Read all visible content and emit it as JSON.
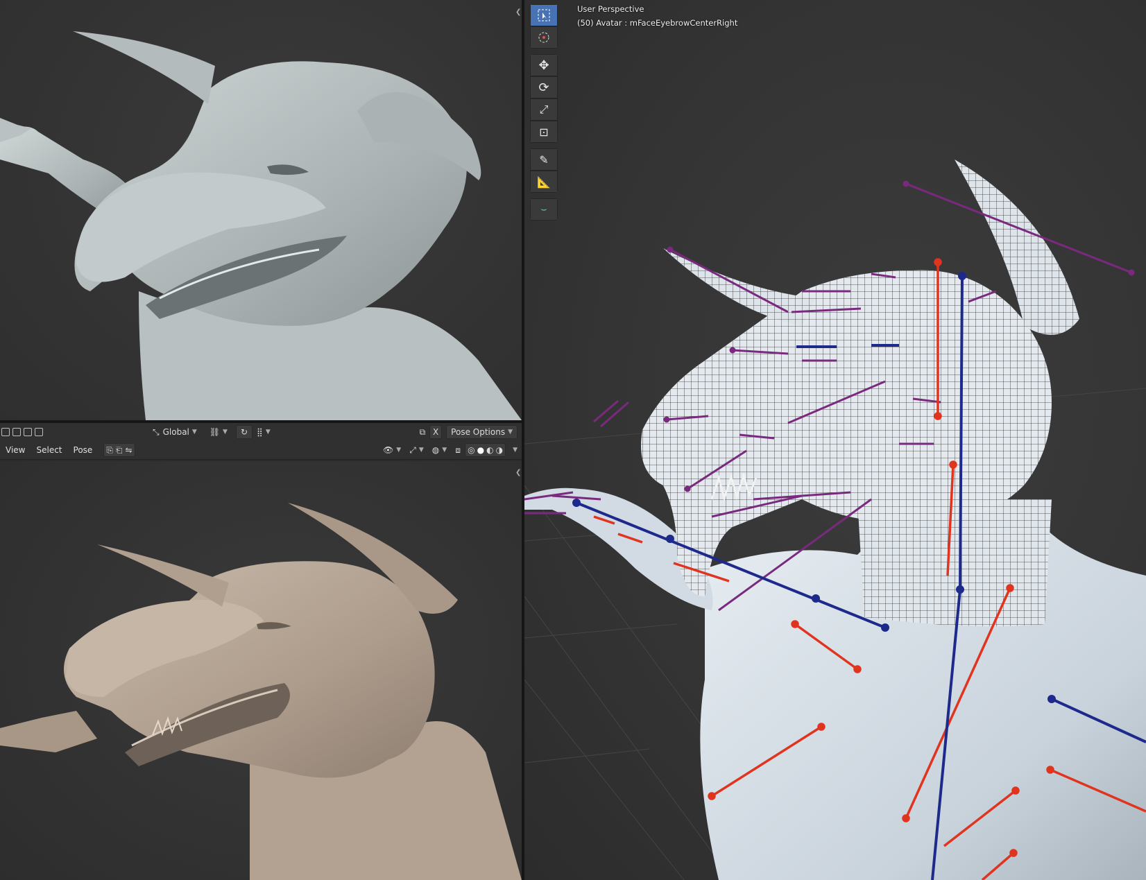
{
  "viewport_right": {
    "title": "User Perspective",
    "subtitle": "(50) Avatar : mFaceEyebrowCenterRight"
  },
  "header_tools": {
    "orientation": "Global",
    "pose_options": "Pose Options",
    "x_mirror": "X"
  },
  "header_menu": {
    "view": "View",
    "select": "Select",
    "pose": "Pose"
  },
  "toolbar": [
    "select-box",
    "cursor",
    "move",
    "rotate",
    "scale",
    "transform",
    "annotate",
    "measure",
    "relax-pose"
  ],
  "colors": {
    "bone_purple": "#7a2a7e",
    "bone_red": "#e0341f",
    "bone_blue": "#1d2a8c",
    "model_grey": "#b7bec0",
    "model_clay": "#b9a898",
    "model_white": "#d6dee6",
    "accent": "#4772b3"
  }
}
